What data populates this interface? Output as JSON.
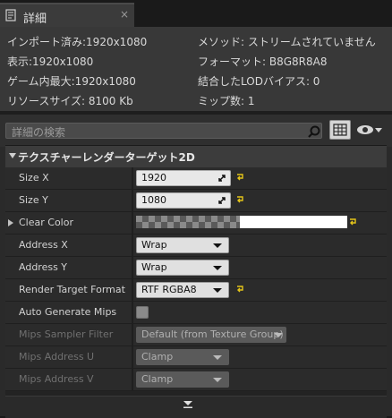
{
  "tab": {
    "title": "詳細",
    "close": "×"
  },
  "info": {
    "import": "インポート済み:1920x1080",
    "display": "表示:1920x1080",
    "game_max": "ゲーム内最大:1920x1080",
    "resource_size": "リソースサイズ: 8100 Kb",
    "method": "メソッド: ストリームされていません",
    "format": "フォーマット: B8G8R8A8",
    "lod_bias": "結合したLODバイアス: 0",
    "mip_count": "ミップ数: 1"
  },
  "search": {
    "placeholder": "詳細の検索"
  },
  "category": {
    "label": "テクスチャーレンダーターゲット2D"
  },
  "props": {
    "size_x": {
      "label": "Size X",
      "value": "1920"
    },
    "size_y": {
      "label": "Size Y",
      "value": "1080"
    },
    "clear_color": {
      "label": "Clear Color"
    },
    "address_x": {
      "label": "Address X",
      "value": "Wrap"
    },
    "address_y": {
      "label": "Address Y",
      "value": "Wrap"
    },
    "rt_format": {
      "label": "Render Target Format",
      "value": "RTF RGBA8"
    },
    "auto_mips": {
      "label": "Auto Generate Mips",
      "checked": false
    },
    "mips_filter": {
      "label": "Mips Sampler Filter",
      "value": "Default (from Texture Group)"
    },
    "mips_u": {
      "label": "Mips Address U",
      "value": "Clamp"
    },
    "mips_v": {
      "label": "Mips Address V",
      "value": "Clamp"
    }
  },
  "colors": {
    "reset_arrow": "#e6c619",
    "panel": "#2a2a2a"
  }
}
